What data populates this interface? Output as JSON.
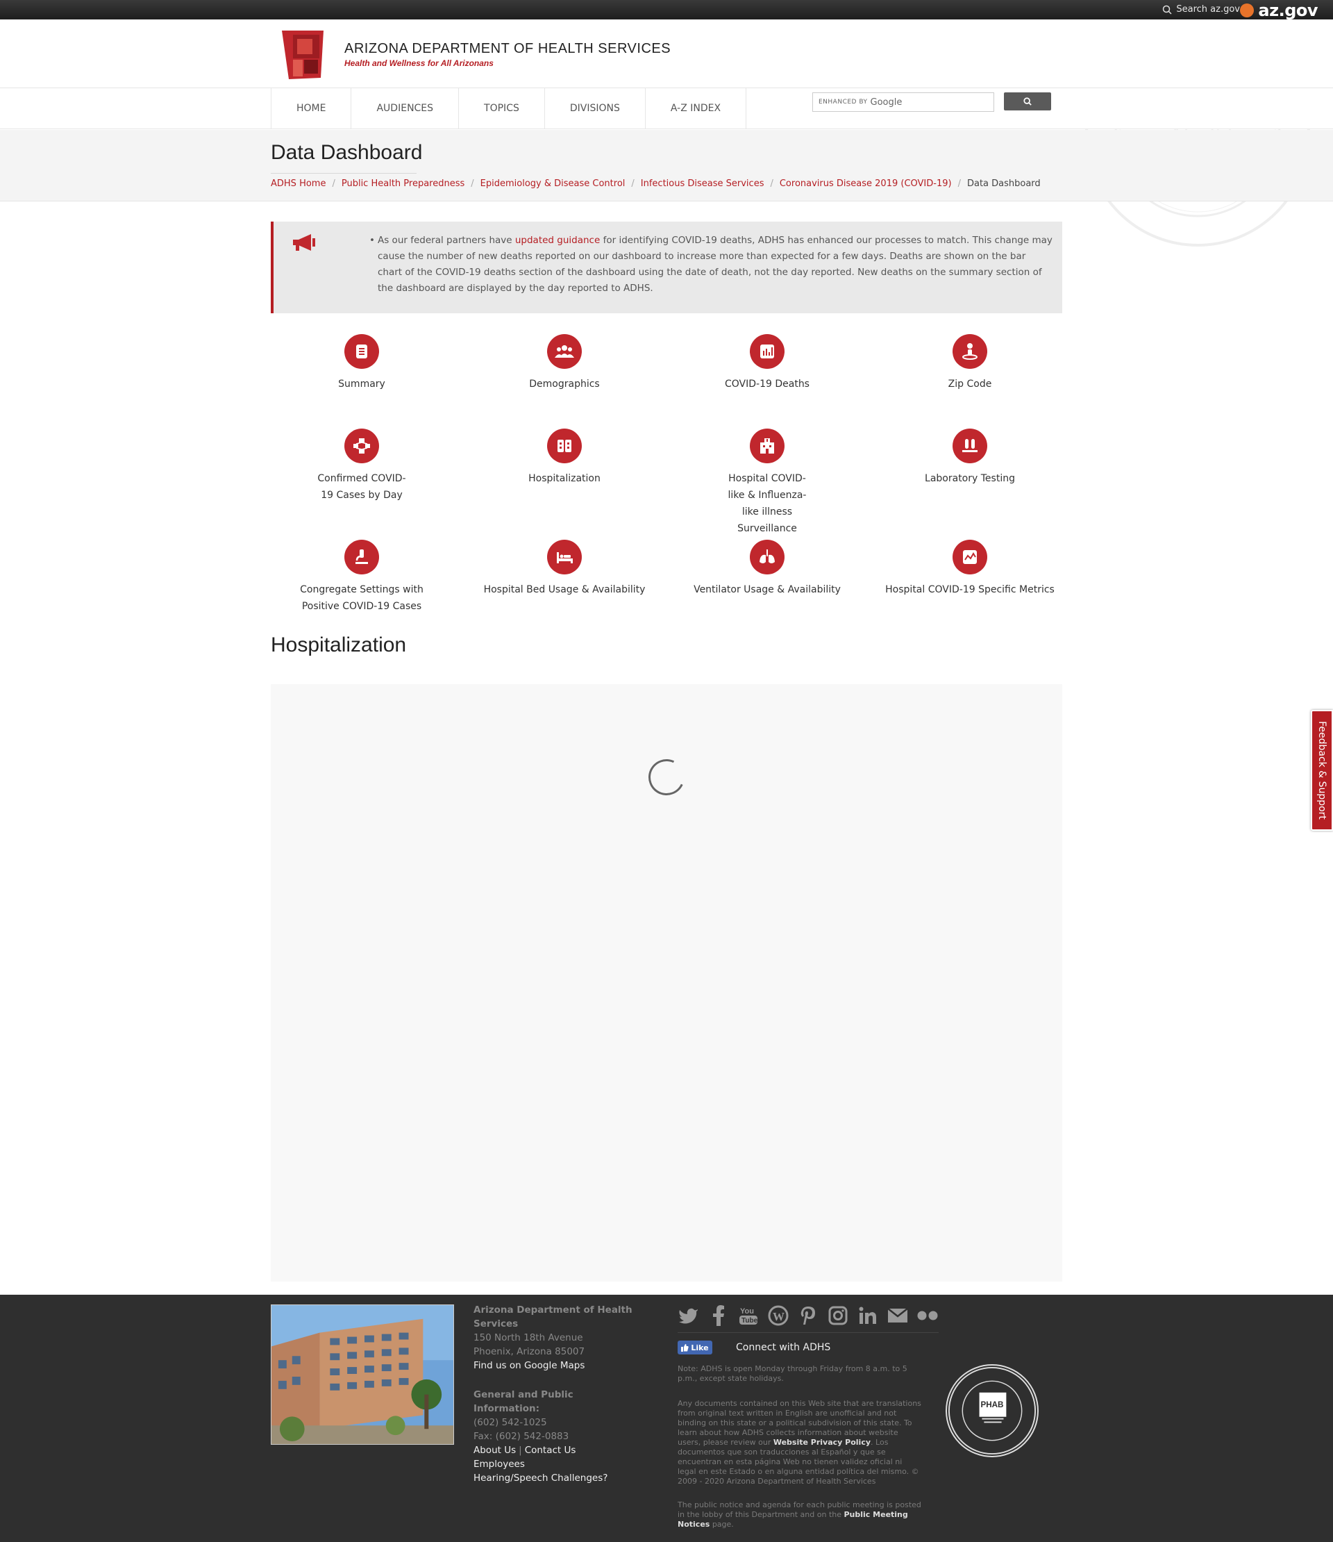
{
  "topbar": {
    "search_label": "Search az.gov",
    "azgov_label": "az.gov"
  },
  "header": {
    "org_title": "ARIZONA DEPARTMENT OF HEALTH SERVICES",
    "tagline": "Health and Wellness for All Arizonans"
  },
  "nav": {
    "items": [
      "HOME",
      "AUDIENCES",
      "TOPICS",
      "DIVISIONS",
      "A-Z INDEX"
    ],
    "search_enhanced": "ENHANCED BY",
    "search_google": "Google"
  },
  "page": {
    "title": "Data Dashboard",
    "breadcrumb": [
      "ADHS Home",
      "Public Health Preparedness",
      "Epidemiology & Disease Control",
      "Infectious Disease Services",
      "Coronavirus Disease 2019 (COVID-19)"
    ],
    "breadcrumb_current": "Data Dashboard",
    "separator": "/"
  },
  "alert": {
    "text_before": "As our federal partners have ",
    "link_text": "updated guidance",
    "text_after": " for identifying COVID-19 deaths, ADHS has enhanced our processes to match. This change may cause the number of new deaths reported on our dashboard to increase more than expected for a few days. Deaths are shown on the bar chart of the COVID-19 deaths section of the dashboard using the date of death, not the day reported. New deaths on the summary section of the dashboard are displayed by the day reported to ADHS."
  },
  "tiles": [
    {
      "label": "Summary",
      "icon": "document-icon"
    },
    {
      "label": "Demographics",
      "icon": "people-icon"
    },
    {
      "label": "COVID-19 Deaths",
      "icon": "bar-chart-icon"
    },
    {
      "label": "Zip Code",
      "icon": "location-person-icon"
    },
    {
      "label": "Confirmed COVID-19 Cases by Day",
      "icon": "network-icon"
    },
    {
      "label": "Hospitalization",
      "icon": "hospital-beds-icon"
    },
    {
      "label": "Hospital COVID-like & Influenza-like illness Surveillance",
      "icon": "hospital-building-icon"
    },
    {
      "label": "Laboratory Testing",
      "icon": "test-tubes-icon"
    },
    {
      "label": "Congregate Settings with Positive COVID-19 Cases",
      "icon": "microscope-icon"
    },
    {
      "label": "Hospital Bed Usage & Availability",
      "icon": "hospital-bed-icon"
    },
    {
      "label": "Ventilator Usage & Availability",
      "icon": "lungs-icon"
    },
    {
      "label": "Hospital COVID-19 Specific Metrics",
      "icon": "line-chart-icon"
    }
  ],
  "section": {
    "title": "Hospitalization"
  },
  "feedback": {
    "label": "Feedback & Support"
  },
  "footer": {
    "org_name": "Arizona Department of Health Services",
    "address_1": "150 North 18th Avenue",
    "address_2": "Phoenix, Arizona 85007",
    "maps_link": "Find us on Google Maps",
    "general_heading": "General and Public Information:",
    "phone": "(602) 542-1025",
    "fax": "Fax: (602) 542-0883",
    "about": "About Us",
    "contact": "Contact Us",
    "employees": "Employees",
    "hearing": "Hearing/Speech Challenges?",
    "like": "Like",
    "connect": "Connect with ADHS",
    "note_hours": "Note: ADHS is open Monday through Friday from 8 a.m. to 5 p.m., except state holidays.",
    "note_translations_1": "Any documents contained on this Web site that are translations from original text written in English are unofficial and not binding on this state or a political subdivision of this state. To learn about how ADHS collects information about website users, please review our ",
    "privacy_link": "Website Privacy Policy",
    "note_translations_2": ". Los documentos que son traducciones al Español y que se encuentran en esta página Web no tienen validez oficial ni legal en este Estado o en alguna entidad política del mismo. © 2009 - 2020 Arizona Department of Health Services",
    "note_meeting_1": "The public notice and agenda for each public meeting is posted in the lobby of this Department and on the ",
    "meeting_link": "Public Meeting Notices",
    "note_meeting_2": " page.",
    "social": [
      "twitter-icon",
      "facebook-icon",
      "youtube-icon",
      "wordpress-icon",
      "pinterest-icon",
      "instagram-icon",
      "linkedin-icon",
      "email-icon",
      "flickr-icon"
    ]
  },
  "colors": {
    "brand_red": "#b51e23",
    "icon_red": "#c0272d",
    "footer_bg": "#2f2f2f"
  }
}
